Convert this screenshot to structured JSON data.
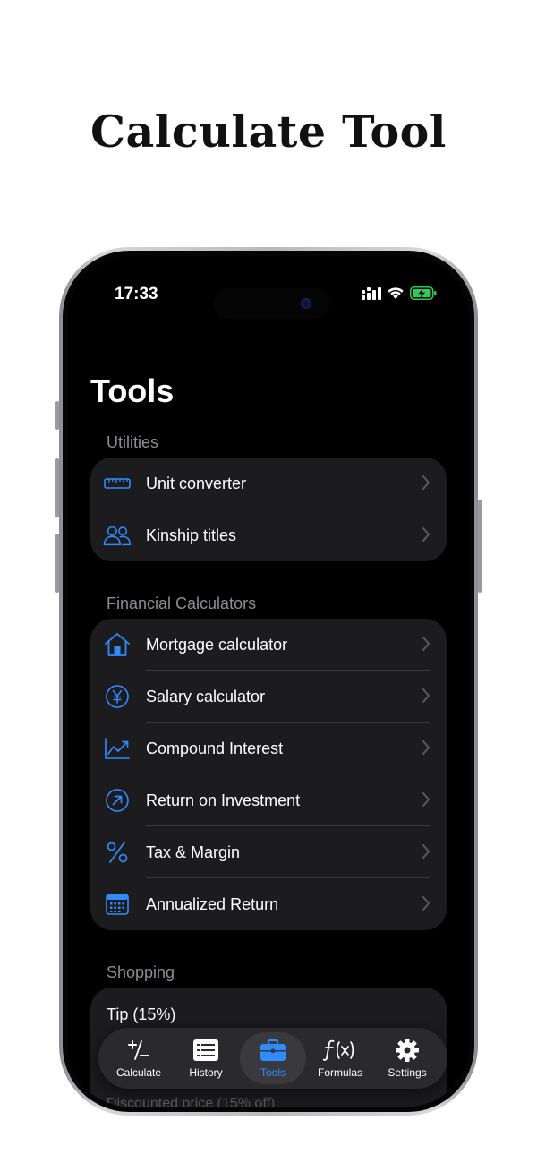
{
  "headline": "Calculate Tool",
  "status_bar": {
    "time": "17:33"
  },
  "page_title": "Tools",
  "sections": {
    "utilities": {
      "header": "Utilities",
      "items": [
        {
          "label": "Unit converter",
          "icon": "ruler-icon"
        },
        {
          "label": "Kinship titles",
          "icon": "people-icon"
        }
      ]
    },
    "financial": {
      "header": "Financial Calculators",
      "items": [
        {
          "label": "Mortgage calculator",
          "icon": "house-icon"
        },
        {
          "label": "Salary calculator",
          "icon": "yen-circle-icon"
        },
        {
          "label": "Compound Interest",
          "icon": "chart-trend-icon"
        },
        {
          "label": "Return on Investment",
          "icon": "arrow-up-right-circle-icon"
        },
        {
          "label": "Tax & Margin",
          "icon": "percent-icon"
        },
        {
          "label": "Annualized Return",
          "icon": "calendar-icon"
        }
      ]
    },
    "shopping": {
      "header": "Shopping",
      "items": [
        {
          "label": "Tip (15%)"
        },
        {
          "label": "Discounted price (15% off)"
        }
      ]
    }
  },
  "tabbar": {
    "tabs": [
      {
        "label": "Calculate",
        "icon": "plus-minus-icon",
        "active": false
      },
      {
        "label": "History",
        "icon": "list-icon",
        "active": false
      },
      {
        "label": "Tools",
        "icon": "briefcase-icon",
        "active": true
      },
      {
        "label": "Formulas",
        "icon": "function-icon",
        "active": false
      },
      {
        "label": "Settings",
        "icon": "gear-icon",
        "active": false
      }
    ]
  },
  "colors": {
    "accent": "#2f8cff",
    "background": "#000000",
    "group": "#1c1c1e",
    "secondary_text": "#8e8e93"
  }
}
